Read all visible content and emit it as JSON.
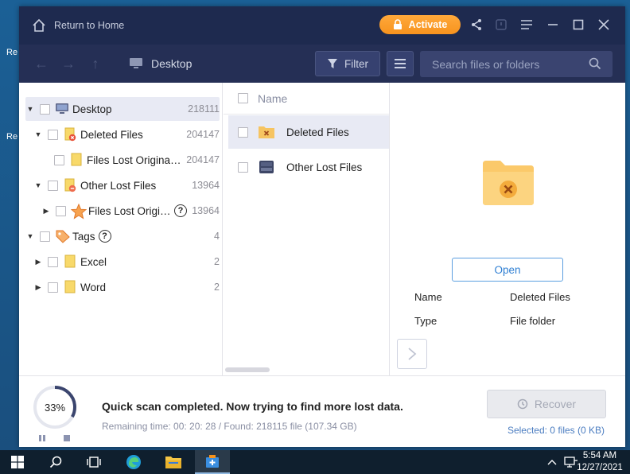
{
  "window": {
    "home_label": "Return to Home",
    "activate_label": "Activate",
    "accent": "#f7931e"
  },
  "navbar": {
    "breadcrumb": "Desktop",
    "filter_label": "Filter",
    "search_placeholder": "Search files or folders"
  },
  "tree": [
    {
      "label": "Desktop",
      "count": "218111"
    },
    {
      "label": "Deleted Files",
      "count": "204147"
    },
    {
      "label": "Files Lost Original ...",
      "count": "204147"
    },
    {
      "label": "Other Lost Files",
      "count": "13964"
    },
    {
      "label": "Files Lost Origin...",
      "count": "13964"
    },
    {
      "label": "Tags",
      "count": "4"
    },
    {
      "label": "Excel",
      "count": "2"
    },
    {
      "label": "Word",
      "count": "2"
    }
  ],
  "list": {
    "header": "Name",
    "items": [
      {
        "label": "Deleted Files"
      },
      {
        "label": "Other Lost Files"
      }
    ]
  },
  "detail": {
    "open_label": "Open",
    "name_key": "Name",
    "name_value": "Deleted Files",
    "type_key": "Type",
    "type_value": "File folder"
  },
  "footer": {
    "progress_text": "33%",
    "progress": 0.33,
    "status": "Quick scan completed. Now trying to find more lost data.",
    "remaining": "Remaining time: 00: 20: 28 / Found: 218115 file (107.34 GB)",
    "recover_label": "Recover",
    "selected": "Selected: 0 files (0 KB)"
  },
  "taskbar": {
    "time": "5:54 AM",
    "date": "12/27/2021"
  },
  "desktop": {
    "labels": [
      "Re",
      "Re"
    ]
  }
}
